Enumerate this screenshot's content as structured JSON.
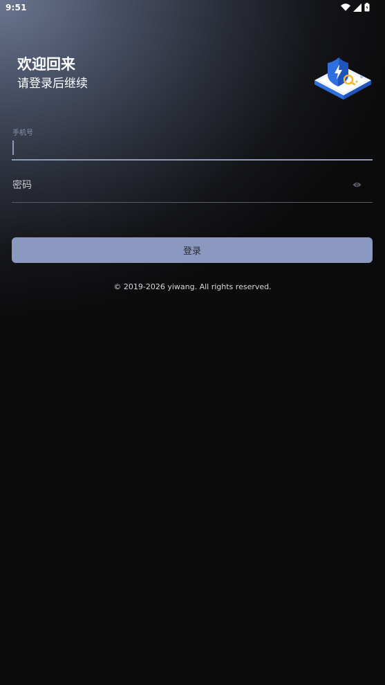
{
  "status_bar": {
    "time": "9:51",
    "icons": [
      "wifi-icon",
      "signal-icon",
      "battery-icon"
    ]
  },
  "header": {
    "title": "欢迎回来",
    "subtitle": "请登录后继续",
    "illustration": "security-shield-illustration"
  },
  "form": {
    "phone_label": "手机号",
    "phone_value": "",
    "password_placeholder": "密码",
    "password_toggle_icon": "eye-icon",
    "login_label": "登录"
  },
  "footer": {
    "copyright": "© 2019-2026 yiwang. All rights reserved."
  },
  "colors": {
    "accent": "#8b98bf",
    "background": "#0b0b0c",
    "text": "#ffffff"
  }
}
